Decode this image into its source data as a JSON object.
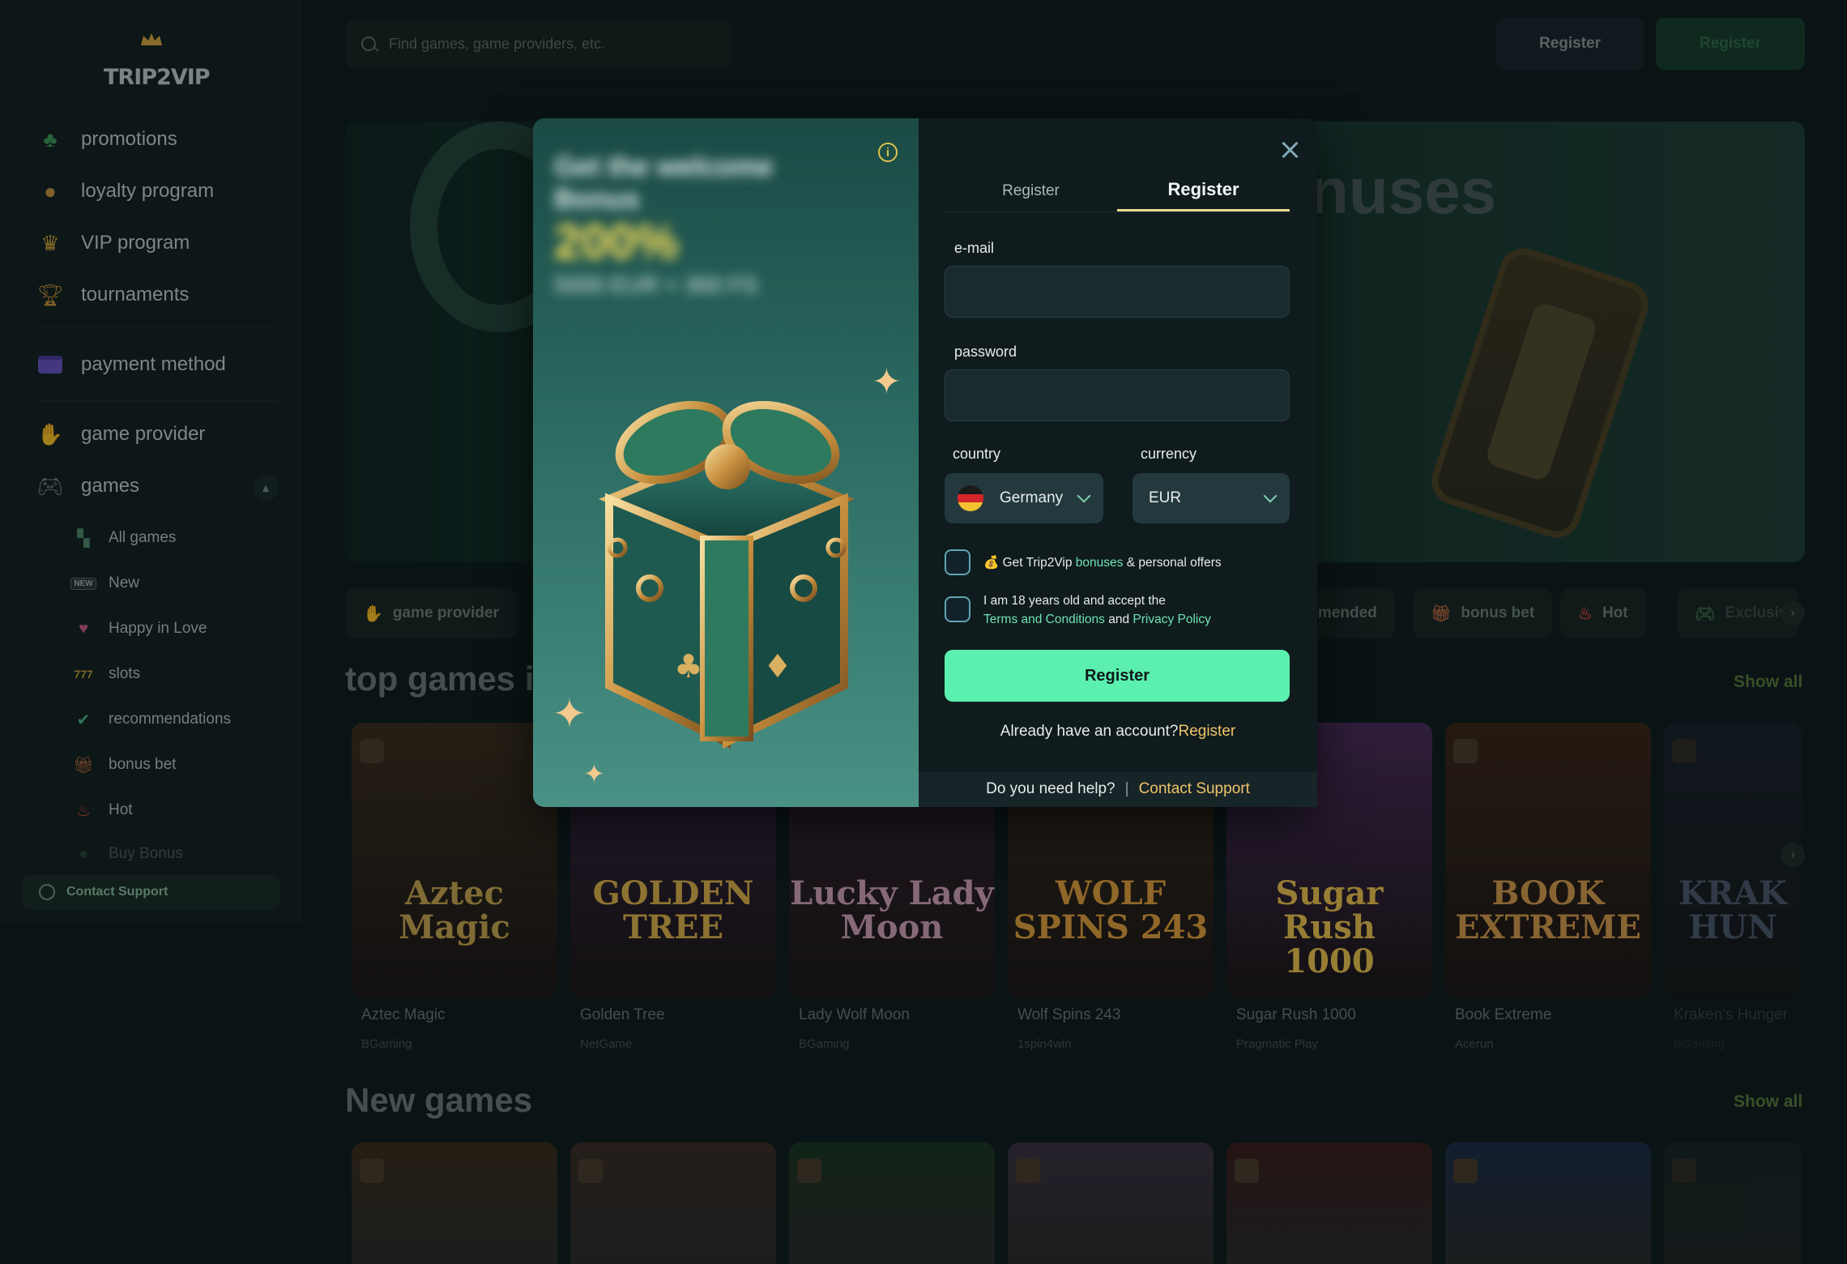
{
  "brand": {
    "logo_text": "TRIP2VIP"
  },
  "search": {
    "placeholder": "Find games, game providers, etc."
  },
  "header": {
    "register_a": "Register",
    "register_b": "Register"
  },
  "sidebar": {
    "main_items": [
      {
        "label": "promotions",
        "icon": "clover-icon"
      },
      {
        "label": "loyalty program",
        "icon": "coin-bag-icon"
      },
      {
        "label": "VIP program",
        "icon": "crown-icon"
      },
      {
        "label": "tournaments",
        "icon": "trophy-icon"
      }
    ],
    "payment": "payment method",
    "provider": "game provider",
    "games": "games",
    "sub_items": [
      {
        "label": "All games",
        "icon": "grid-icon"
      },
      {
        "label": "New",
        "icon": "new-badge-icon",
        "badge": "NEW"
      },
      {
        "label": "Happy in Love",
        "icon": "heart-icon"
      },
      {
        "label": "slots",
        "icon": "slot-machine-icon"
      },
      {
        "label": "recommendations",
        "icon": "check-badge-icon"
      },
      {
        "label": "bonus bet",
        "icon": "gift-icon"
      },
      {
        "label": "Hot",
        "icon": "flame-icon"
      },
      {
        "label": "Buy Bonus",
        "icon": "money-bag-icon"
      }
    ],
    "support": "Contact Support"
  },
  "hero": {
    "title_fragment": "nuses"
  },
  "pills": [
    {
      "label": "game provider",
      "icon": "hands-icon"
    },
    {
      "label": "mmended",
      "icon": ""
    },
    {
      "label": "bonus bet",
      "icon": "gift-icon"
    },
    {
      "label": "Hot",
      "icon": "flame-icon"
    },
    {
      "label": "Exclusiv",
      "icon": "gamepad-icon"
    }
  ],
  "sections": {
    "top_title": "top games i",
    "new_title": "New games",
    "show_all": "Show all"
  },
  "top_games": [
    {
      "name": "Aztec Magic",
      "provider": "BGaming",
      "art": "Aztec\nMagic",
      "color": "#caa74e",
      "bg": "#3a2c1c"
    },
    {
      "name": "Golden Tree",
      "provider": "NetGame",
      "art": "GOLDEN\nTREE",
      "color": "#e0b34a",
      "bg": "#3a2346"
    },
    {
      "name": "Lady Wolf Moon",
      "provider": "BGaming",
      "art": "Lucky Lady\nMoon",
      "color": "#d6a4b8",
      "bg": "#3a2338"
    },
    {
      "name": "Wolf Spins 243",
      "provider": "1spin4win",
      "art": "WOLF\nSPINS 243",
      "color": "#e5a13a",
      "bg": "#3b2a1a"
    },
    {
      "name": "Sugar Rush 1000",
      "provider": "Pragmatic Play",
      "art": "Sugar Rush\n1000",
      "color": "#f1c64e",
      "bg": "#4a2a5a"
    },
    {
      "name": "Book Extreme",
      "provider": "Acerun",
      "art": "BOOK\nEXTREME",
      "color": "#d89b4c",
      "bg": "#3a2415"
    },
    {
      "name": "Kraken's Hunger",
      "provider": "BGaming",
      "art": "KRAK\nHUN",
      "color": "#8090b0",
      "bg": "#202438"
    }
  ],
  "new_games_bgs": [
    "#3a2a1a",
    "#3a2a24",
    "#1a3320",
    "#3a3040",
    "#3a1a1a",
    "#1a2a48",
    "#1e2a2a"
  ],
  "modal": {
    "promo": {
      "line1": "Get the welcome",
      "line2": "Bonus",
      "line3": "200%",
      "line4": "5000 EUR + 300 FS"
    },
    "tabs": [
      "Register",
      "Register"
    ],
    "email_label": "e-mail",
    "email_value": "",
    "password_label": "password",
    "password_value": "",
    "country_label": "country",
    "country_value": "Germany",
    "currency_label": "currency",
    "currency_value": "EUR",
    "offers": {
      "prefix": "💰 Get Trip2Vip ",
      "link": "bonuses",
      "suffix": " & personal offers"
    },
    "terms": {
      "line1": "I am 18 years old and accept the",
      "link1": "Terms and Conditions",
      "and": " and ",
      "link2": "Privacy Policy"
    },
    "submit": "Register",
    "already_text": "Already have an account?",
    "already_link": "Register",
    "help_text": "Do you need help?",
    "help_sep": "|",
    "help_link": "Contact Support"
  },
  "colors": {
    "accent_green": "#5cf0b0",
    "link_gold": "#f2c36b",
    "highlight_green": "#6fe2b4",
    "background": "#0e1a1c"
  }
}
